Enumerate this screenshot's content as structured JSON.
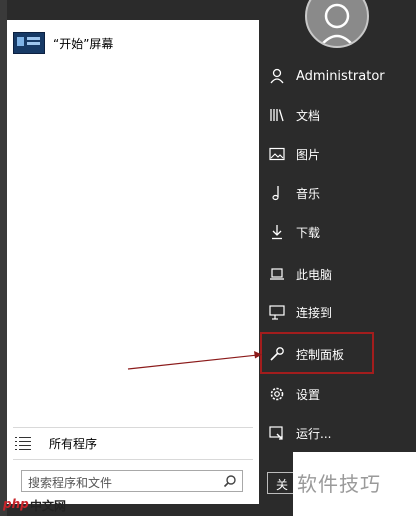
{
  "left": {
    "pinned_label": "“开始”屏幕",
    "all_programs": "所有程序",
    "search_placeholder": "搜索程序和文件"
  },
  "right": {
    "items": [
      {
        "label": "Administrator",
        "icon": "user-icon"
      },
      {
        "label": "文档",
        "icon": "library-icon"
      },
      {
        "label": "图片",
        "icon": "picture-icon"
      },
      {
        "label": "音乐",
        "icon": "music-note-icon"
      },
      {
        "label": "下载",
        "icon": "download-icon"
      },
      {
        "label": "此电脑",
        "icon": "laptop-icon"
      },
      {
        "label": "连接到",
        "icon": "connect-icon"
      },
      {
        "label": "控制面板",
        "icon": "wrench-icon"
      },
      {
        "label": "设置",
        "icon": "gear-icon"
      },
      {
        "label": "运行...",
        "icon": "run-icon"
      }
    ],
    "shutdown_label": "关"
  },
  "watermark": {
    "text": "软件技巧",
    "logo": "php",
    "site": "中文网"
  },
  "colors": {
    "background": "#2b2b2b",
    "left_panel": "#ffffff",
    "highlight_border": "#a31d1d",
    "arrow": "#8b1a1a"
  }
}
